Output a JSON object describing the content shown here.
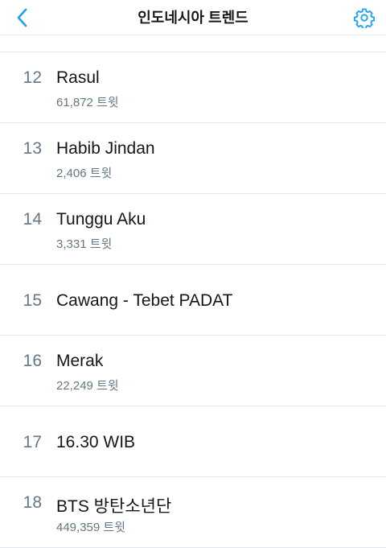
{
  "header": {
    "title": "인도네시아 트렌드",
    "back_icon": "chevron-left-icon",
    "settings_icon": "gear-icon"
  },
  "colors": {
    "accent": "#1da1f2",
    "primary_text": "#14171a",
    "secondary_text": "#657786",
    "divider": "#e1e8ed"
  },
  "trends": [
    {
      "rank": "12",
      "name": "Rasul",
      "count": "61,872 트윗"
    },
    {
      "rank": "13",
      "name": "Habib Jindan",
      "count": "2,406 트윗"
    },
    {
      "rank": "14",
      "name": "Tunggu Aku",
      "count": "3,331 트윗"
    },
    {
      "rank": "15",
      "name": "Cawang - Tebet PADAT",
      "count": ""
    },
    {
      "rank": "16",
      "name": "Merak",
      "count": "22,249 트윗"
    },
    {
      "rank": "17",
      "name": "16.30 WIB",
      "count": ""
    },
    {
      "rank": "18",
      "name": "BTS 방탄소년단",
      "count": "449,359 트윗"
    }
  ]
}
